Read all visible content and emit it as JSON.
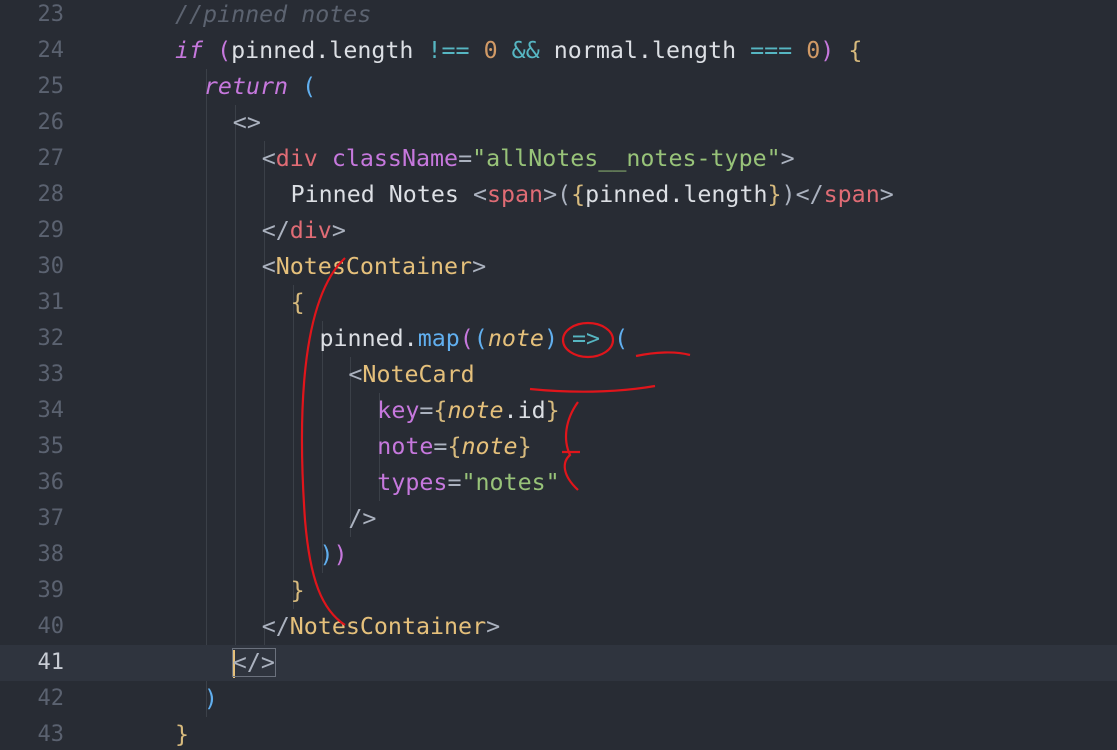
{
  "editor": {
    "current_line": 41,
    "lines": [
      {
        "n": "23",
        "parts": [
          [
            "comment",
            "//pinned notes"
          ]
        ],
        "indent": 2
      },
      {
        "n": "24",
        "parts": [
          [
            "kw",
            "if"
          ],
          [
            "punc",
            " "
          ],
          [
            "brace2",
            "("
          ],
          [
            "text",
            "pinned.length "
          ],
          [
            "op",
            "!=="
          ],
          [
            "punc",
            " "
          ],
          [
            "num",
            "0"
          ],
          [
            "punc",
            " "
          ],
          [
            "op",
            "&&"
          ],
          [
            "text",
            " normal.length "
          ],
          [
            "op",
            "==="
          ],
          [
            "punc",
            " "
          ],
          [
            "num",
            "0"
          ],
          [
            "brace2",
            ")"
          ],
          [
            "punc",
            " "
          ],
          [
            "brace1",
            "{"
          ]
        ],
        "indent": 2
      },
      {
        "n": "25",
        "parts": [
          [
            "kw",
            "return"
          ],
          [
            "punc",
            " "
          ],
          [
            "paren",
            "("
          ]
        ],
        "indent": 4
      },
      {
        "n": "26",
        "parts": [
          [
            "punc",
            "<>"
          ]
        ],
        "indent": 6
      },
      {
        "n": "27",
        "parts": [
          [
            "punc",
            "<"
          ],
          [
            "tag",
            "div"
          ],
          [
            "punc",
            " "
          ],
          [
            "attr",
            "className"
          ],
          [
            "punc",
            "="
          ],
          [
            "str",
            "\"allNotes__notes-type\""
          ],
          [
            "punc",
            ">"
          ]
        ],
        "indent": 8
      },
      {
        "n": "28",
        "parts": [
          [
            "text",
            "Pinned Notes "
          ],
          [
            "punc",
            "<"
          ],
          [
            "tag",
            "span"
          ],
          [
            "punc",
            ">("
          ],
          [
            "brace1",
            "{"
          ],
          [
            "text",
            "pinned.length"
          ],
          [
            "brace1",
            "}"
          ],
          [
            "punc",
            ")</"
          ],
          [
            "tag",
            "span"
          ],
          [
            "punc",
            ">"
          ]
        ],
        "indent": 10
      },
      {
        "n": "29",
        "parts": [
          [
            "punc",
            "</"
          ],
          [
            "tag",
            "div"
          ],
          [
            "punc",
            ">"
          ]
        ],
        "indent": 8
      },
      {
        "n": "30",
        "parts": [
          [
            "punc",
            "<"
          ],
          [
            "comp",
            "NotesContainer"
          ],
          [
            "punc",
            ">"
          ]
        ],
        "indent": 8
      },
      {
        "n": "31",
        "parts": [
          [
            "brace1",
            "{"
          ]
        ],
        "indent": 10
      },
      {
        "n": "32",
        "parts": [
          [
            "text",
            "pinned."
          ],
          [
            "fn",
            "map"
          ],
          [
            "brace2",
            "("
          ],
          [
            "paren",
            "("
          ],
          [
            "param",
            "note"
          ],
          [
            "paren",
            ")"
          ],
          [
            "punc",
            " "
          ],
          [
            "op",
            "=>"
          ],
          [
            "punc",
            " "
          ],
          [
            "paren",
            "("
          ]
        ],
        "indent": 12
      },
      {
        "n": "33",
        "parts": [
          [
            "punc",
            "<"
          ],
          [
            "comp",
            "NoteCard"
          ]
        ],
        "indent": 14
      },
      {
        "n": "34",
        "parts": [
          [
            "attr",
            "key"
          ],
          [
            "punc",
            "="
          ],
          [
            "brace1",
            "{"
          ],
          [
            "param",
            "note"
          ],
          [
            "text",
            ".id"
          ],
          [
            "brace1",
            "}"
          ]
        ],
        "indent": 16
      },
      {
        "n": "35",
        "parts": [
          [
            "attr",
            "note"
          ],
          [
            "punc",
            "="
          ],
          [
            "brace1",
            "{"
          ],
          [
            "param",
            "note"
          ],
          [
            "brace1",
            "}"
          ]
        ],
        "indent": 16
      },
      {
        "n": "36",
        "parts": [
          [
            "attr",
            "types"
          ],
          [
            "punc",
            "="
          ],
          [
            "str",
            "\"notes\""
          ]
        ],
        "indent": 16
      },
      {
        "n": "37",
        "parts": [
          [
            "punc",
            "/>"
          ]
        ],
        "indent": 14
      },
      {
        "n": "38",
        "parts": [
          [
            "paren",
            ")"
          ],
          [
            "brace2",
            ")"
          ]
        ],
        "indent": 12
      },
      {
        "n": "39",
        "parts": [
          [
            "brace1",
            "}"
          ]
        ],
        "indent": 10
      },
      {
        "n": "40",
        "parts": [
          [
            "punc",
            "</"
          ],
          [
            "comp",
            "NotesContainer"
          ],
          [
            "punc",
            ">"
          ]
        ],
        "indent": 8
      },
      {
        "n": "41",
        "parts": [
          [
            "cursor",
            ""
          ],
          [
            "box",
            "</>"
          ]
        ],
        "indent": 6
      },
      {
        "n": "42",
        "parts": [
          [
            "paren",
            ")"
          ]
        ],
        "indent": 4
      },
      {
        "n": "43",
        "parts": [
          [
            "brace1",
            "}"
          ]
        ],
        "indent": 2
      }
    ]
  },
  "colors": {
    "background": "#282c34",
    "current_line": "#2f343e",
    "annotation": "#e0151b"
  }
}
